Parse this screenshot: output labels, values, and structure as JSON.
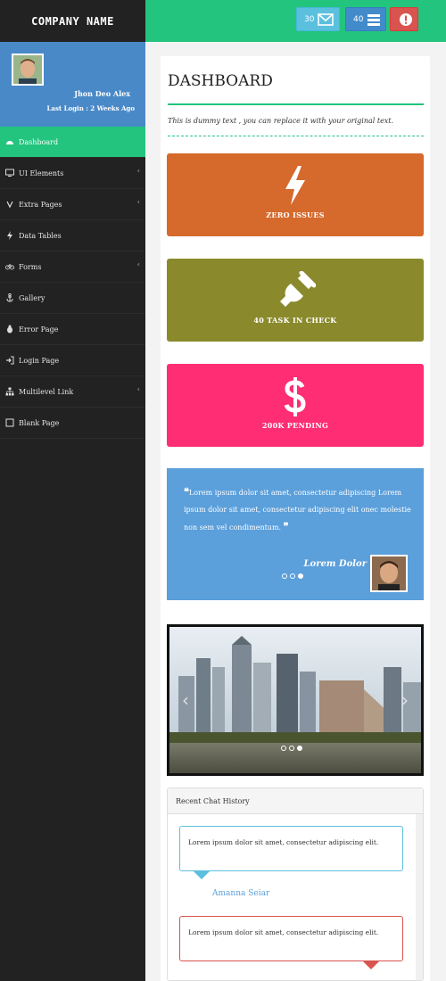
{
  "brand": {
    "name": "COMPANY NAME"
  },
  "topbar": {
    "messages_count": "30",
    "tasks_count": "40"
  },
  "user": {
    "name": "Jhon Deo Alex",
    "last_login": "Last Login : 2 Weeks Ago"
  },
  "sidebar": {
    "items": [
      {
        "label": "Dashboard",
        "icon": "dashboard-icon",
        "active": true
      },
      {
        "label": "UI Elements",
        "icon": "desktop-icon",
        "has_submenu": true
      },
      {
        "label": "Extra Pages",
        "icon": "code-icon",
        "has_submenu": true
      },
      {
        "label": "Data Tables",
        "icon": "bolt-icon"
      },
      {
        "label": "Forms",
        "icon": "bicycle-icon",
        "has_submenu": true
      },
      {
        "label": "Gallery",
        "icon": "anchor-icon"
      },
      {
        "label": "Error Page",
        "icon": "bug-icon"
      },
      {
        "label": "Login Page",
        "icon": "sign-in-icon"
      },
      {
        "label": "Multilevel Link",
        "icon": "sitemap-icon",
        "has_submenu": true
      },
      {
        "label": "Blank Page",
        "icon": "square-icon"
      }
    ]
  },
  "main": {
    "title": "DASHBOARD",
    "subtitle": "This is dummy text , you can replace it with your original text.",
    "stats": [
      {
        "label": "ZERO ISSUES",
        "icon": "bolt-icon",
        "color": "#d6692c"
      },
      {
        "label": "40 TASK IN CHECK",
        "icon": "plug-icon",
        "color": "#8a8a2d"
      },
      {
        "label": "200K PENDING",
        "icon": "dollar-icon",
        "color": "#ff2d74"
      }
    ],
    "quote": {
      "text": "Lorem ipsum dolor sit amet, consectetur adipiscing Lorem ipsum dolor sit amet, consectetur adipiscing elit onec molestie non sem vel condimentum.",
      "author": "Lorem Dolor"
    },
    "chat": {
      "title": "Recent Chat History",
      "messages": [
        {
          "text": "Lorem ipsum dolor sit amet, consectetur adipiscing elit.",
          "name": "Amanna Seiar"
        },
        {
          "text": "Lorem ipsum dolor sit amet, consectetur adipiscing elit.",
          "name": ""
        }
      ]
    }
  },
  "colors": {
    "accent": "#22c47e",
    "sidebar": "#222222",
    "user_panel": "#4a89c8"
  }
}
